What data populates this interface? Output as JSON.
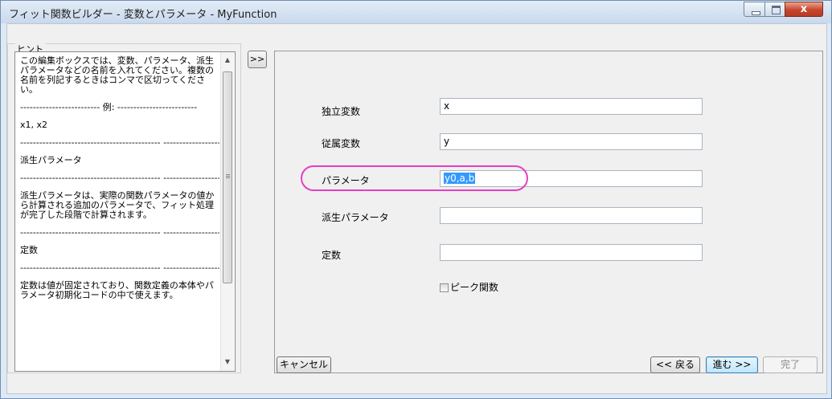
{
  "window": {
    "title": "フィット関数ビルダー - 変数とパラメータ - MyFunction",
    "close_glyph": "x"
  },
  "hint": {
    "group_title": "ヒント",
    "lines": [
      "この編集ボックスでは、変数、パラメータ、派生パラメータなどの名前を入れてください。複数の名前を列記するときはコンマで区切ってください。",
      "------------------------- 例:\n-------------------------",
      "x1, x2",
      "--------------------------------------------\n-------------------",
      "派生パラメータ",
      "--------------------------------------------\n-------------------",
      "派生パラメータは、実際の関数パラメータの値から計算される追加のパラメータで、フィット処理が完了した段階で計算されます。",
      "--------------------------------------------\n-------------------",
      "定数",
      "--------------------------------------------\n-------------------",
      "定数は値が固定されており、関数定義の本体やパラメータ初期化コードの中で使えます。"
    ]
  },
  "toggle_label": ">>",
  "form": {
    "independent_label": "独立変数",
    "independent_value": "x",
    "dependent_label": "従属変数",
    "dependent_value": "y",
    "parameters_label": "パラメータ",
    "parameters_value": "y0,a,b",
    "derived_label": "派生パラメータ",
    "derived_value": "",
    "constants_label": "定数",
    "constants_value": "",
    "peak_label": "ピーク関数",
    "peak_checked": false
  },
  "buttons": {
    "cancel": "キャンセル",
    "back": "<< 戻る",
    "next": "進む >>",
    "finish": "完了"
  },
  "colors": {
    "highlight_oval": "#e63ec4",
    "selection": "#3399ff"
  }
}
